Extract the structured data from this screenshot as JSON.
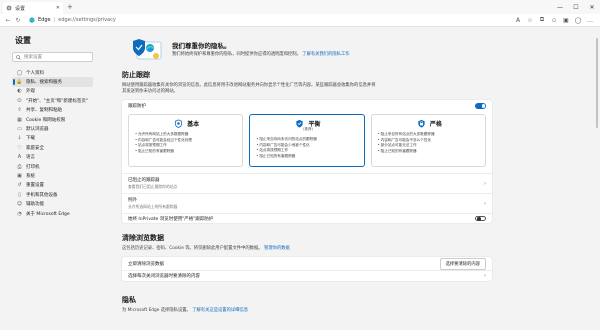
{
  "browser": {
    "tab_title": "设置",
    "url_host": "Edge",
    "url_path": "edge://settings/privacy",
    "close_glyph": "✕"
  },
  "sidebar": {
    "title": "设置",
    "search_placeholder": "搜索设置",
    "items": [
      {
        "label": "个人资料",
        "icon": "person-icon"
      },
      {
        "label": "隐私、搜索和服务",
        "icon": "lock-icon",
        "active": true
      },
      {
        "label": "外观",
        "icon": "palette-icon"
      },
      {
        "label": "\"开始\"、\"主页\"和\"新建标签页\"",
        "icon": "power-icon"
      },
      {
        "label": "共享、复制和粘贴",
        "icon": "share-icon"
      },
      {
        "label": "Cookie 和网站权限",
        "icon": "cookie-icon"
      },
      {
        "label": "默认浏览器",
        "icon": "browser-icon"
      },
      {
        "label": "下载",
        "icon": "download-icon"
      },
      {
        "label": "家庭安全",
        "icon": "family-icon"
      },
      {
        "label": "语言",
        "icon": "language-icon"
      },
      {
        "label": "打印机",
        "icon": "printer-icon"
      },
      {
        "label": "系统",
        "icon": "system-icon"
      },
      {
        "label": "重置设置",
        "icon": "reset-icon"
      },
      {
        "label": "手机和其他设备",
        "icon": "phone-icon"
      },
      {
        "label": "辅助功能",
        "icon": "accessibility-icon"
      },
      {
        "label": "关于 Microsoft Edge",
        "icon": "edge-icon"
      }
    ]
  },
  "hero": {
    "title": "我们尊重你的隐私。",
    "desc1": "我们将始终保护和尊重你的隐私，同时提供你应得的透明度和控制。",
    "link": "了解有关我们的隐私工作"
  },
  "tracking": {
    "title": "防止跟踪",
    "desc": "网站使用跟踪器收集有关你的浏览的信息。此信息将用于改进网站服务并向你显示个性化广告等内容。某些跟踪器会收集你的信息并将其发送到你未访问过的网站。",
    "toggle_label": "跟踪防护",
    "levels": [
      {
        "name": "基本",
        "sub": "",
        "bullets": [
          "允许所有网站上的大多数跟踪器",
          "内容和广告可能会经过个性化处理",
          "站点将按预期工作",
          "阻止已知的有害跟踪器"
        ]
      },
      {
        "name": "平衡",
        "sub": "(推荐)",
        "bullets": [
          "阻止来自你尚未访问的站点的跟踪器",
          "内容和广告可能会少地被个性化",
          "站点将按预期工作",
          "阻止已知的有害跟踪器"
        ]
      },
      {
        "name": "严格",
        "sub": "",
        "bullets": [
          "阻止来自所有站点的大多数跟踪器",
          "内容和广告可能会不怎么个性化",
          "部分站点可能无法工作",
          "阻止已知的有害跟踪器"
        ]
      }
    ],
    "blocked_title": "已阻止的跟踪器",
    "blocked_desc": "查看我们已阻止跟踪你的站点",
    "exceptions_title": "例外",
    "exceptions_desc": "允许所选网站上的所有跟踪器",
    "inprivate_label": "始终 InPrivate 浏览时使用\"严格\"跟踪防护"
  },
  "clear": {
    "title": "清除浏览数据",
    "desc": "这包括历史记录、密码、Cookie 等。将仅删除此用户配置文件中的数据。",
    "desc_link": "管理你的数据",
    "now_label": "立即清除浏览数据",
    "now_button": "选择要清除的内容",
    "onclose_label": "选择每次关闭浏览器时要清除的内容"
  },
  "privacy": {
    "title": "隐私",
    "desc": "为 Microsoft Edge 选择隐私设置。",
    "link": "了解有关这些设置的详细信息"
  },
  "colors": {
    "accent": "#0f6cbd"
  }
}
